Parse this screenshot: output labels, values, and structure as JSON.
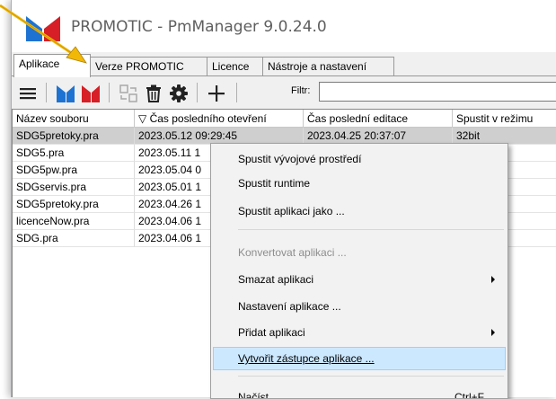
{
  "window": {
    "title": "PROMOTIC - PmManager 9.0.24.0",
    "brand_colors": {
      "blue": "#1e73d2",
      "red": "#d61f26"
    }
  },
  "tabs": [
    {
      "label": "Aplikace",
      "active": true
    },
    {
      "label": "Verze PROMOTIC",
      "active": false
    },
    {
      "label": "Licence",
      "active": false
    },
    {
      "label": "Nástroje a nastavení",
      "active": false
    }
  ],
  "toolbar": {
    "filter_label": "Filtr:",
    "filter_value": "",
    "icons": [
      "menu-icon",
      "promotic-blue-logo-icon",
      "promotic-red-logo-icon",
      "convert-icon",
      "delete-icon",
      "gear-icon",
      "plus-icon"
    ]
  },
  "grid": {
    "columns": [
      "Název souboru",
      "▽ Čas posledního otevření",
      "Čas poslední editace",
      "Spustit v režimu"
    ],
    "rows": [
      {
        "file": "SDG5pretoky.pra",
        "opened": "2023.05.12 09:29:45",
        "edited": "2023.04.25 20:37:07",
        "mode": "32bit",
        "selected": true
      },
      {
        "file": "SDG5.pra",
        "opened": "2023.05.11 1",
        "edited": "",
        "mode": "",
        "selected": false
      },
      {
        "file": "SDG5pw.pra",
        "opened": "2023.05.04 0",
        "edited": "",
        "mode": "",
        "selected": false
      },
      {
        "file": "SDGservis.pra",
        "opened": "2023.05.01 1",
        "edited": "",
        "mode": "",
        "selected": false
      },
      {
        "file": "SDG5pretoky.pra",
        "opened": "2023.04.26 1",
        "edited": "",
        "mode": "",
        "selected": false
      },
      {
        "file": "licenceNow.pra",
        "opened": "2023.04.06 1",
        "edited": "",
        "mode": "",
        "selected": false
      },
      {
        "file": "SDG.pra",
        "opened": "2023.04.06 1",
        "edited": "",
        "mode": "",
        "selected": false
      }
    ]
  },
  "context_menu": {
    "items": [
      {
        "label": "Spustit vývojové prostředí"
      },
      {
        "label": "Spustit runtime"
      },
      {
        "label": "Spustit aplikaci jako ..."
      },
      {
        "label": "Konvertovat aplikaci ...",
        "disabled": true
      },
      {
        "label": "Smazat aplikaci",
        "submenu": true
      },
      {
        "label": "Nastavení aplikace ..."
      },
      {
        "label": "Přidat aplikaci",
        "submenu": true
      },
      {
        "label": "Vytvořit zástupce aplikace ...",
        "highlighted": true
      },
      {
        "label": "Načíst",
        "shortcut": "Ctrl+F"
      }
    ]
  }
}
